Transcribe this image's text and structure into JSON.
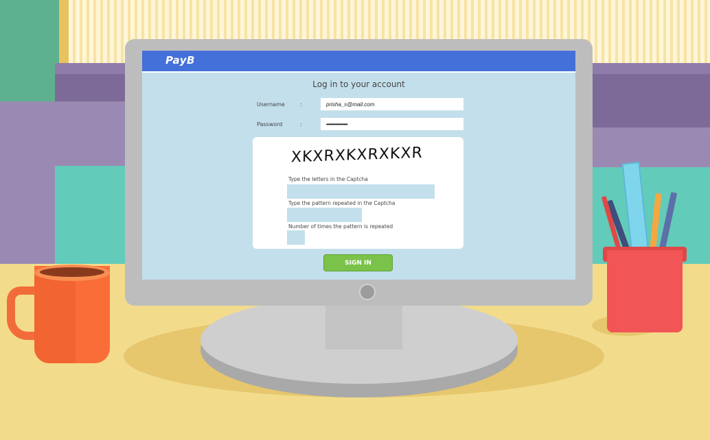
{
  "app": {
    "logo": "PayB"
  },
  "login": {
    "title": "Log in to your account",
    "username_label": "Username",
    "password_label": "Password",
    "colon": ":",
    "username_value": "prisha_s@mail.com",
    "password_value": "•••••••••••••••••"
  },
  "captcha": {
    "text": "XKXRXKXRXKXR",
    "letters_label": "Type the letters in the Captcha",
    "pattern_label": "Type the pattern repeated in the Captcha",
    "count_label": "Number of times the pattern is repeated"
  },
  "signin_label": "SIGN IN",
  "colors": {
    "topbar": "#4470d9",
    "screen_bg": "#c3dfec",
    "signin": "#7bc24a"
  }
}
